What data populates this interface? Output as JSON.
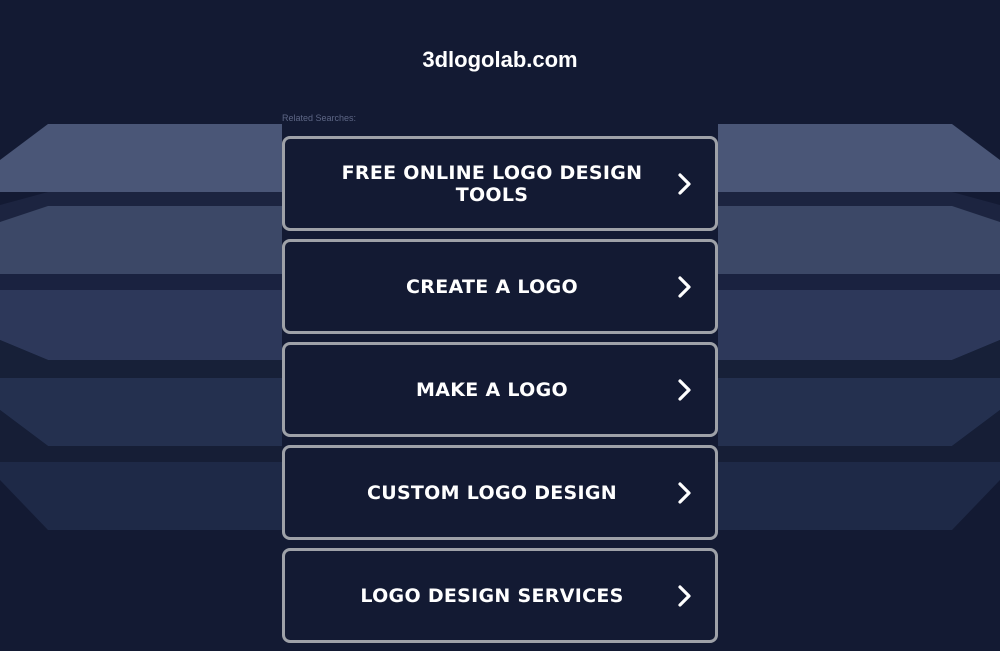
{
  "site": {
    "title": "3dlogolab.com"
  },
  "related": {
    "label": "Related Searches:"
  },
  "links": [
    {
      "label": "FREE ONLINE LOGO DESIGN TOOLS",
      "icon": "chevron-right-icon"
    },
    {
      "label": "CREATE A LOGO",
      "icon": "chevron-right-icon"
    },
    {
      "label": "MAKE A LOGO",
      "icon": "chevron-right-icon"
    },
    {
      "label": "CUSTOM LOGO DESIGN",
      "icon": "chevron-right-icon"
    },
    {
      "label": "LOGO DESIGN SERVICES",
      "icon": "chevron-right-icon"
    }
  ],
  "colors": {
    "background": "#131a33",
    "button_border": "#9ea1a8",
    "text": "#ffffff",
    "label": "#5d6685"
  }
}
